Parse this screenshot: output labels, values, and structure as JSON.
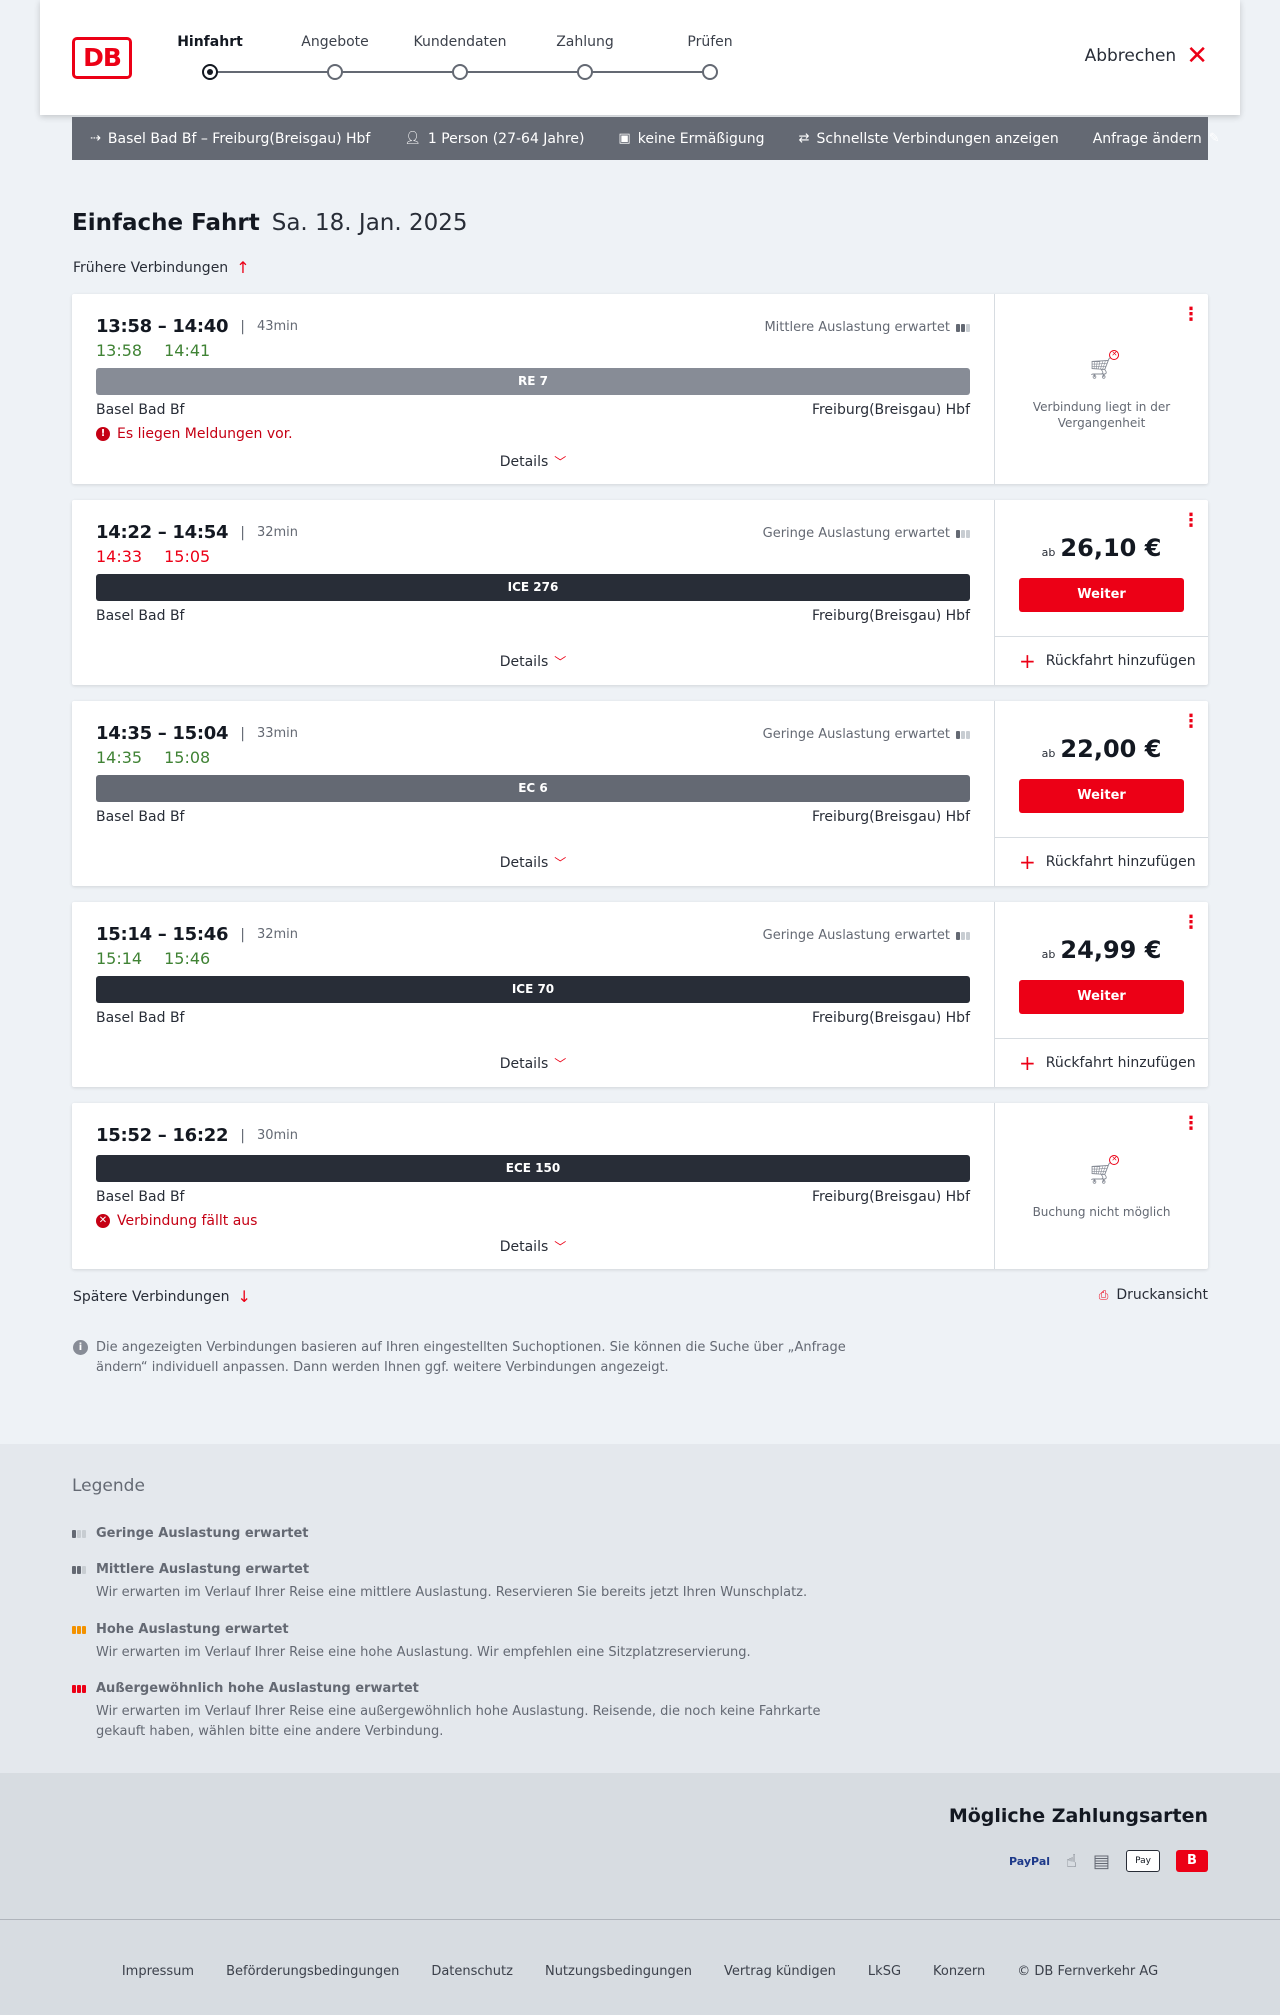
{
  "header": {
    "logo_text": "DB",
    "steps": [
      "Hinfahrt",
      "Angebote",
      "Kundendaten",
      "Zahlung",
      "Prüfen"
    ],
    "cancel_label": "Abbrechen"
  },
  "query": {
    "route": "Basel Bad Bf – Freiburg(Breisgau) Hbf",
    "persons": "1 Person (27-64 Jahre)",
    "discount": "keine Ermäßigung",
    "options": "Schnellste Verbindungen anzeigen",
    "change": "Anfrage ändern"
  },
  "page": {
    "title": "Einfache Fahrt",
    "date": "Sa. 18. Jan. 2025",
    "earlier": "Frühere Verbindungen",
    "later": "Spätere Verbindungen",
    "print": "Druckansicht",
    "info": "Die angezeigten Verbindungen basieren auf Ihren eingestellten Suchoptionen. Sie können die Suche über „Anfrage ändern“ individuell anpassen. Dann werden Ihnen ggf. weitere Verbindungen angezeigt."
  },
  "connections": [
    {
      "time": "13:58 – 14:40",
      "duration": "43min",
      "occupancy": "Mittlere Auslastung erwartet",
      "actual_dep": "13:58",
      "actual_arr": "14:41",
      "train": "RE 7",
      "from": "Basel Bad Bf",
      "to": "Freiburg(Breisgau) Hbf",
      "message": "Es liegen Meldungen vor.",
      "details": "Details",
      "unavailable": "Verbindung liegt in der Vergangenheit"
    },
    {
      "time": "14:22 – 14:54",
      "duration": "32min",
      "occupancy": "Geringe Auslastung erwartet",
      "actual_dep": "14:33",
      "actual_arr": "15:05",
      "train": "ICE 276",
      "from": "Basel Bad Bf",
      "to": "Freiburg(Breisgau) Hbf",
      "details": "Details",
      "price_prefix": "ab",
      "price": "26,10 €",
      "button": "Weiter",
      "return": "Rückfahrt hinzufügen"
    },
    {
      "time": "14:35 – 15:04",
      "duration": "33min",
      "occupancy": "Geringe Auslastung erwartet",
      "actual_dep": "14:35",
      "actual_arr": "15:08",
      "train": "EC 6",
      "from": "Basel Bad Bf",
      "to": "Freiburg(Breisgau) Hbf",
      "details": "Details",
      "price_prefix": "ab",
      "price": "22,00 €",
      "button": "Weiter",
      "return": "Rückfahrt hinzufügen"
    },
    {
      "time": "15:14 – 15:46",
      "duration": "32min",
      "occupancy": "Geringe Auslastung erwartet",
      "actual_dep": "15:14",
      "actual_arr": "15:46",
      "train": "ICE 70",
      "from": "Basel Bad Bf",
      "to": "Freiburg(Breisgau) Hbf",
      "details": "Details",
      "price_prefix": "ab",
      "price": "24,99 €",
      "button": "Weiter",
      "return": "Rückfahrt hinzufügen"
    },
    {
      "time": "15:52 – 16:22",
      "duration": "30min",
      "train": "ECE 150",
      "from": "Basel Bad Bf",
      "to": "Freiburg(Breisgau) Hbf",
      "message": "Verbindung fällt aus",
      "details": "Details",
      "unavailable": "Buchung nicht möglich"
    }
  ],
  "legend": {
    "title": "Legende",
    "items": [
      {
        "title": "Geringe Auslastung erwartet",
        "text": "",
        "color": "#646973"
      },
      {
        "title": "Mittlere Auslastung erwartet",
        "text": "Wir erwarten im Verlauf Ihrer Reise eine mittlere Auslastung. Reservieren Sie bereits jetzt Ihren Wunschplatz.",
        "color": "#646973"
      },
      {
        "title": "Hohe Auslastung erwartet",
        "text": "Wir erwarten im Verlauf Ihrer Reise eine hohe Auslastung. Wir empfehlen eine Sitzplatzreservierung.",
        "color": "#f39200"
      },
      {
        "title": "Außergewöhnlich hohe Auslastung erwartet",
        "text": "Wir erwarten im Verlauf Ihrer Reise eine außergewöhnlich hohe Auslastung. Reisende, die noch keine Fahrkarte gekauft haben, wählen bitte eine andere Verbindung.",
        "color": "#ec0016"
      }
    ]
  },
  "payment": {
    "title": "Mögliche Zahlungsarten",
    "paypal": "PayPal",
    "applepay": "Pay"
  },
  "footer": {
    "links": [
      "Impressum",
      "Beförderungsbedingungen",
      "Datenschutz",
      "Nutzungsbedingungen",
      "Vertrag kündigen",
      "LkSG",
      "Konzern",
      "© DB Fernverkehr AG"
    ]
  }
}
